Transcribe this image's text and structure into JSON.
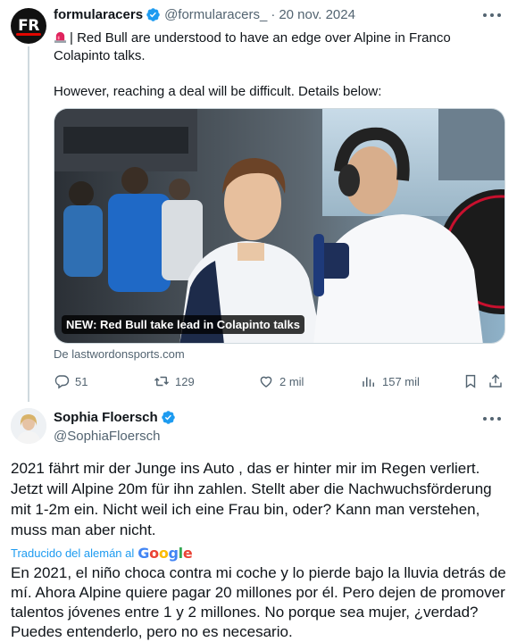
{
  "tweet1": {
    "author_name": "formularacers",
    "handle": "@formularacers_",
    "separator": "·",
    "date": "20 nov. 2024",
    "avatar_text": "FR",
    "text_line1": "| Red Bull are understood to have an edge over Alpine in Franco Colapinto talks.",
    "text_line2": "However, reaching a deal will be difficult. Details below:",
    "media_caption": "NEW: Red Bull take lead in Colapinto talks",
    "source": "De lastwordonsports.com",
    "actions": {
      "replies": "51",
      "reposts": "129",
      "likes": "2 mil",
      "views": "157 mil"
    }
  },
  "tweet2": {
    "author_name": "Sophia Floersch",
    "handle": "@SophiaFloersch",
    "text": "2021 fährt mir der Junge ins Auto , das er hinter mir im Regen verliert. Jetzt will Alpine 20m für ihn zahlen. Stellt aber die Nachwuchsförderung mit 1-2m ein. Nicht weil ich eine Frau bin, oder? Kann man verstehen, muss man aber nicht.",
    "translated_label": "Traducido del alemán al",
    "translator": "Google",
    "translation": "En 2021, el niño choca contra mi coche y lo pierde bajo la lluvia detrás de mí. Ahora Alpine quiere pagar 20 millones por él. Pero dejen de promover talentos jóvenes entre 1 y 2 millones. No porque sea mujer, ¿verdad? Puedes entenderlo, pero no es necesario."
  },
  "colors": {
    "accent": "#1d9bf0",
    "text": "#0f1419",
    "muted": "#536471",
    "border": "#cfd9de"
  },
  "icons": [
    "verified-badge-icon",
    "siren-icon",
    "more-icon",
    "reply-icon",
    "repost-icon",
    "like-icon",
    "views-icon",
    "bookmark-icon",
    "share-icon",
    "google-logo"
  ]
}
